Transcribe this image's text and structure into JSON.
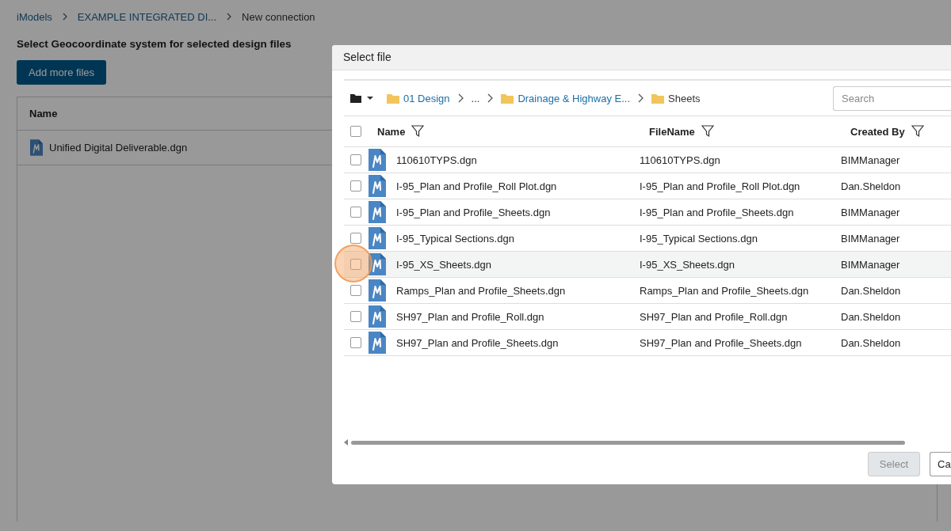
{
  "breadcrumbs": [
    {
      "label": "iModels",
      "link": true
    },
    {
      "label": "EXAMPLE INTEGRATED DI...",
      "link": true
    },
    {
      "label": "New connection",
      "link": false
    }
  ],
  "page_title": "Select Geocoordinate system for selected design files",
  "add_button": "Add more files",
  "files_table": {
    "columns": [
      "Name"
    ],
    "rows": [
      "Unified Digital Deliverable.dgn"
    ]
  },
  "dialog": {
    "title": "Select file",
    "path": [
      {
        "label": "01 Design",
        "kind": "folder",
        "link": true
      },
      {
        "label": "...",
        "kind": "ellipsis",
        "link": false
      },
      {
        "label": "Drainage & Highway E...",
        "kind": "folder",
        "link": true
      },
      {
        "label": "Sheets",
        "kind": "folder",
        "link": false
      }
    ],
    "search": {
      "placeholder": "Search"
    },
    "select_all_checked": false,
    "columns": [
      "Name",
      "FileName",
      "Created By"
    ],
    "rows": [
      {
        "name": "110610TYPS.dgn",
        "file_name": "110610TYPS.dgn",
        "created_by": "BIMManager",
        "checked": false,
        "highlighted": false
      },
      {
        "name": "I-95_Plan and Profile_Roll Plot.dgn",
        "file_name": "I-95_Plan and Profile_Roll Plot.dgn",
        "created_by": "Dan.Sheldon",
        "checked": false,
        "highlighted": false
      },
      {
        "name": "I-95_Plan and Profile_Sheets.dgn",
        "file_name": "I-95_Plan and Profile_Sheets.dgn",
        "created_by": "BIMManager",
        "checked": false,
        "highlighted": false
      },
      {
        "name": "I-95_Typical Sections.dgn",
        "file_name": "I-95_Typical Sections.dgn",
        "created_by": "BIMManager",
        "checked": false,
        "highlighted": false
      },
      {
        "name": "I-95_XS_Sheets.dgn",
        "file_name": "I-95_XS_Sheets.dgn",
        "created_by": "BIMManager",
        "checked": false,
        "highlighted": true
      },
      {
        "name": "Ramps_Plan and Profile_Sheets.dgn",
        "file_name": "Ramps_Plan and Profile_Sheets.dgn",
        "created_by": "Dan.Sheldon",
        "checked": false,
        "highlighted": false
      },
      {
        "name": "SH97_Plan and Profile_Roll.dgn",
        "file_name": "SH97_Plan and Profile_Roll.dgn",
        "created_by": "Dan.Sheldon",
        "checked": false,
        "highlighted": false
      },
      {
        "name": "SH97_Plan and Profile_Sheets.dgn",
        "file_name": "SH97_Plan and Profile_Sheets.dgn",
        "created_by": "Dan.Sheldon",
        "checked": false,
        "highlighted": false
      }
    ],
    "buttons": [
      {
        "label": "Select",
        "disabled": true
      },
      {
        "label": "Ca",
        "disabled": false
      }
    ]
  }
}
